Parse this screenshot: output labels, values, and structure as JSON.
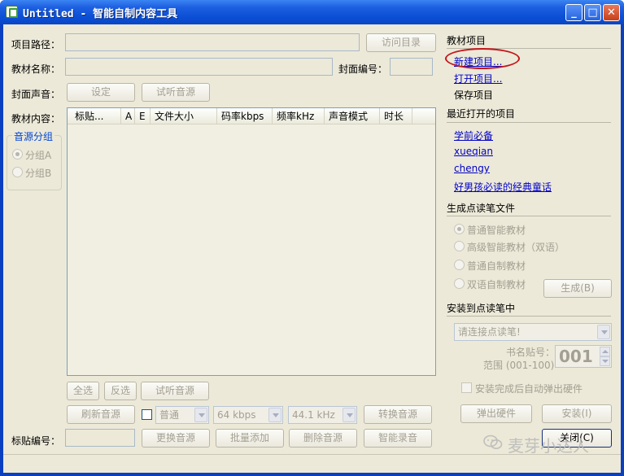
{
  "window": {
    "title": "Untitled - 智能自制内容工具",
    "min_glyph": "_",
    "max_glyph": "□",
    "close_glyph": "✕"
  },
  "form": {
    "project_path_label": "项目路径：",
    "browse_label": "访问目录",
    "material_name_label": "教材名称：",
    "cover_number_label": "封面编号：",
    "cover_sound_label": "封面声音：",
    "set_label": "设定",
    "preview_label": "试听音源",
    "content_label": "教材内容：",
    "sticker_number_label": "标贴编号："
  },
  "listview": {
    "columns": [
      "标贴...",
      "A",
      "E",
      "文件大小",
      "码率kbps",
      "频率kHz",
      "声音模式",
      "时长"
    ]
  },
  "sound_group": {
    "title": "音源分组",
    "option_a": "分组A",
    "option_b": "分组B"
  },
  "bottom": {
    "select_all": "全选",
    "invert": "反选",
    "preview": "试听音源",
    "refresh": "刷新音源",
    "mode_value": "普通",
    "bitrate_value": "64 kbps",
    "freq_value": "44.1 kHz",
    "convert": "转换音源",
    "replace": "更换音源",
    "batch_add": "批量添加",
    "delete": "删除音源",
    "smart_record": "智能录音"
  },
  "right": {
    "project_section": "教材项目",
    "new_project": "新建项目...",
    "open_project": "打开项目...",
    "save_project": "保存项目",
    "recent_section": "最近打开的项目",
    "recent": [
      "学前必备",
      "xueqian",
      "chengy",
      "好男孩必读的经典童话"
    ],
    "generate_section": "生成点读笔文件",
    "gen_options": [
      "普通智能教材",
      "高级智能教材（双语）",
      "普通自制教材",
      "双语自制教材"
    ],
    "generate_button": "生成(B)",
    "install_section": "安装到点读笔中",
    "pen_placeholder": "请连接点读笔!",
    "book_number_label": "书名贴号：",
    "range_label": "范围 (001-100)",
    "book_number_value": "001",
    "auto_eject_label": "安装完成后自动弹出硬件",
    "eject_button": "弹出硬件",
    "install_button": "安装(I)",
    "close_button": "关闭(C)"
  },
  "watermark": {
    "text": "麦芽小达人"
  }
}
